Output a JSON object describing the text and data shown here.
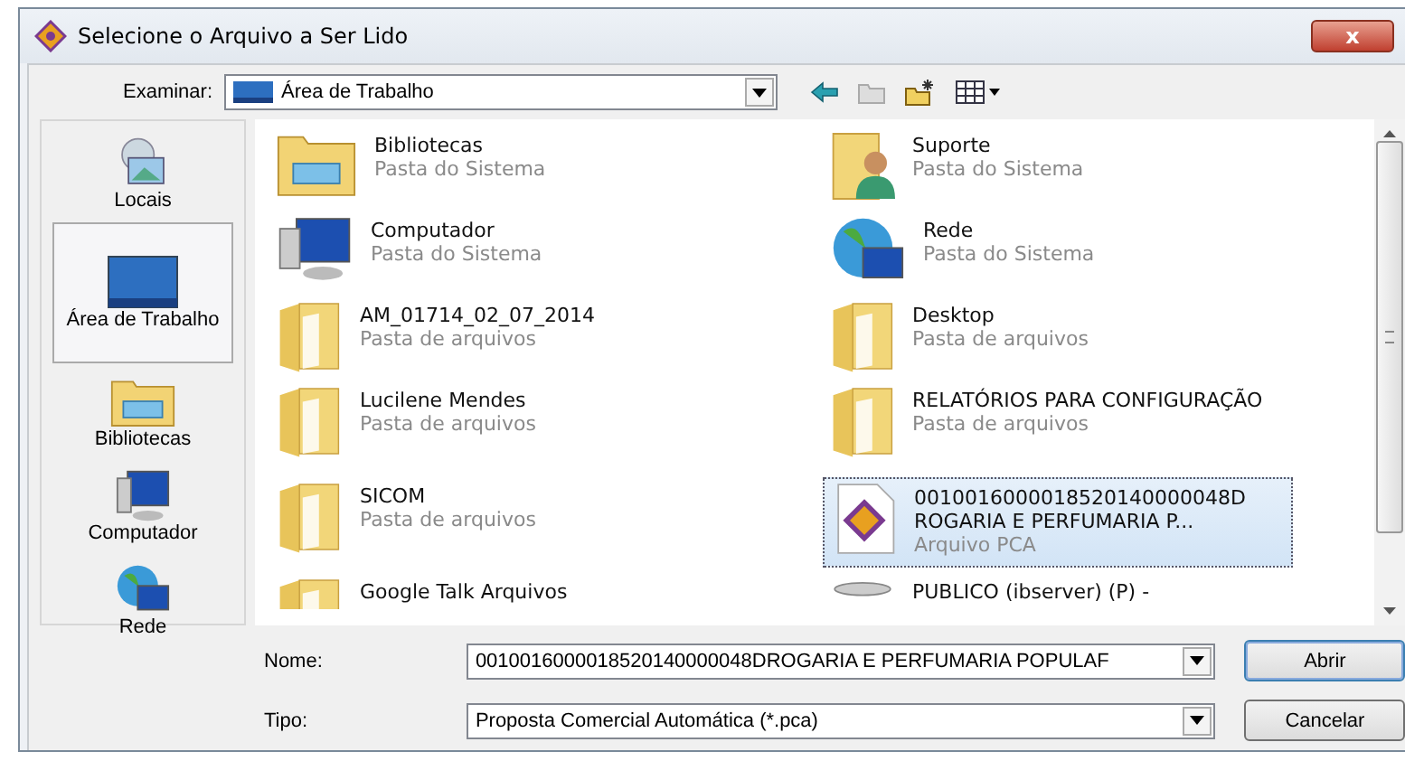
{
  "window": {
    "title": "Selecione o Arquivo a Ser Lido",
    "close": "x"
  },
  "lookin": {
    "label": "Examinar:",
    "value": "Área de Trabalho"
  },
  "places": [
    {
      "label": "Locais",
      "kind": "recent",
      "selected": false
    },
    {
      "label": "Área de Trabalho",
      "kind": "desktop",
      "selected": true
    },
    {
      "label": "Bibliotecas",
      "kind": "library",
      "selected": false
    },
    {
      "label": "Computador",
      "kind": "computer",
      "selected": false
    },
    {
      "label": "Rede",
      "kind": "network",
      "selected": false
    }
  ],
  "items": [
    {
      "name": "Bibliotecas",
      "type": "Pasta do Sistema",
      "kind": "library",
      "selected": false
    },
    {
      "name": "Suporte",
      "type": "Pasta do Sistema",
      "kind": "user",
      "selected": false
    },
    {
      "name": "Computador",
      "type": "Pasta do Sistema",
      "kind": "computer",
      "selected": false
    },
    {
      "name": "Rede",
      "type": "Pasta do Sistema",
      "kind": "network",
      "selected": false
    },
    {
      "name": "AM_01714_02_07_2014",
      "type": "Pasta de arquivos",
      "kind": "folder",
      "selected": false
    },
    {
      "name": "Desktop",
      "type": "Pasta de arquivos",
      "kind": "folder",
      "selected": false
    },
    {
      "name": "Lucilene Mendes",
      "type": "Pasta de arquivos",
      "kind": "folder",
      "selected": false
    },
    {
      "name": "RELATÓRIOS PARA CONFIGURAÇÃO",
      "type": "Pasta de arquivos",
      "kind": "folder",
      "selected": false
    },
    {
      "name": "SICOM",
      "type": "Pasta de arquivos",
      "kind": "folder",
      "selected": false
    },
    {
      "name": "0010016000018520140000048D ROGARIA E PERFUMARIA P...",
      "type": "Arquivo PCA",
      "kind": "pca",
      "selected": true
    },
    {
      "name": "Google Talk Arquivos",
      "kind": "folder",
      "selected": false
    },
    {
      "name": "PUBLICO (ibserver) (P) -",
      "kind": "drive",
      "selected": false
    }
  ],
  "filename": {
    "label": "Nome:",
    "value": "0010016000018520140000048DROGARIA E PERFUMARIA POPULAF"
  },
  "filetype": {
    "label": "Tipo:",
    "value": "Proposta Comercial Automática (*.pca)"
  },
  "buttons": [
    {
      "label": "Abrir",
      "default": true
    },
    {
      "label": "Cancelar",
      "default": false
    }
  ]
}
